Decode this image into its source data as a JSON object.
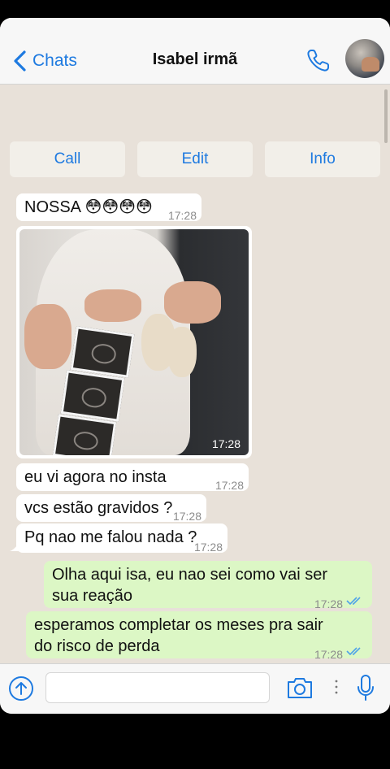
{
  "header": {
    "back_label": "Chats",
    "title": "Isabel irmã"
  },
  "actions": {
    "call": "Call",
    "edit": "Edit",
    "info": "Info"
  },
  "messages": [
    {
      "text": "NOSSA 😳😳😳😳",
      "time": "17:28",
      "dir": "in"
    },
    {
      "text": "",
      "time": "17:28",
      "dir": "in",
      "type": "photo"
    },
    {
      "text": "eu vi agora no insta",
      "time": "17:28",
      "dir": "in"
    },
    {
      "text": "vcs estão gravidos ?",
      "time": "17:28",
      "dir": "in"
    },
    {
      "text": "Pq nao me falou nada ?",
      "time": "17:28",
      "dir": "in"
    },
    {
      "text": "Olha aqui isa, eu nao sei como vai ser sua reação",
      "line1": "Olha aqui isa, eu nao sei como vai ser",
      "line2": "sua reação",
      "time": "17:28",
      "dir": "out"
    },
    {
      "text": "esperamos completar os meses pra sair do risco de perda",
      "line1": "esperamos completar os meses pra sair",
      "line2": "do risco de perda",
      "time": "17:28",
      "dir": "out"
    }
  ],
  "input": {
    "placeholder": "",
    "value": ""
  },
  "colors": {
    "accent": "#1e7ae0",
    "incoming": "#ffffff",
    "outgoing": "#dcf7c5",
    "background": "#e8e1d9",
    "read_ticks": "#4fa3e8"
  },
  "icons": [
    "chevron-left-icon",
    "phone-icon",
    "avatar",
    "attach-icon",
    "camera-icon",
    "more-icon",
    "mic-icon",
    "double-check-icon"
  ]
}
